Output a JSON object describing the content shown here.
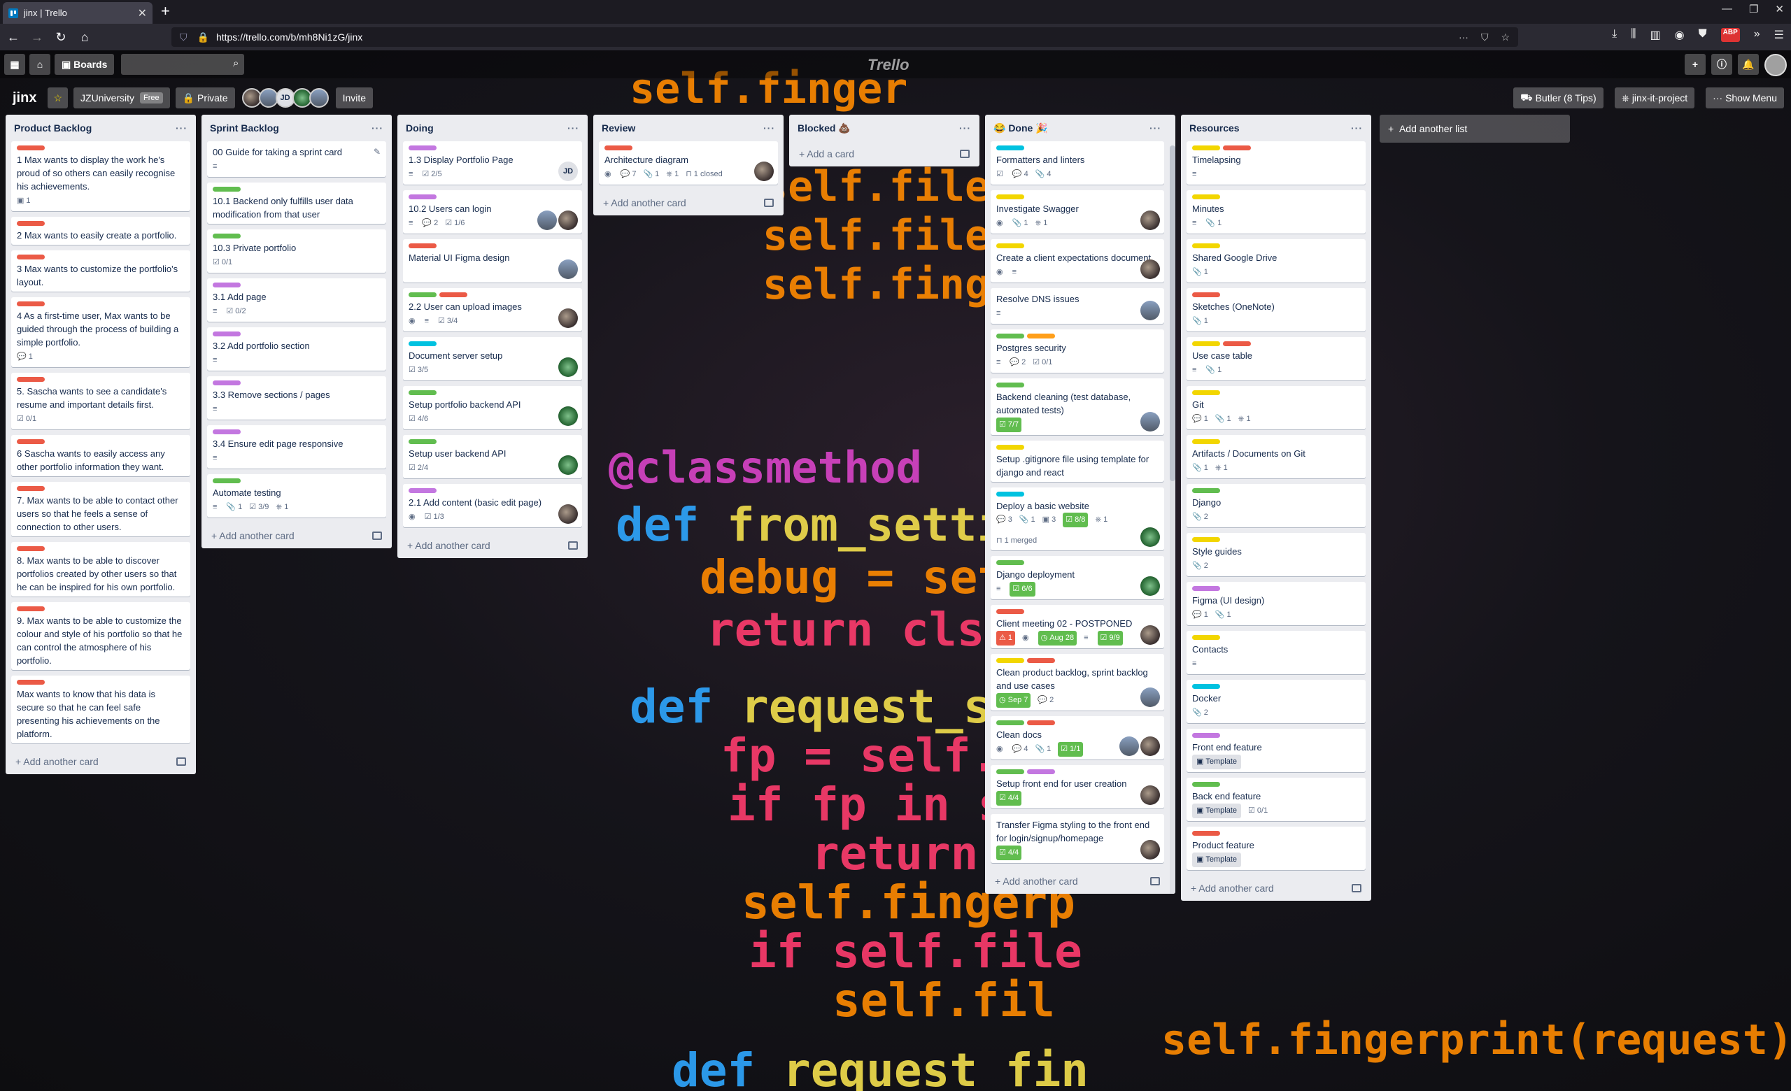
{
  "browser": {
    "tab_title": "jinx | Trello",
    "url": "https://trello.com/b/mh8Ni1zG/jinx"
  },
  "header": {
    "boards_label": "Boards",
    "logo": "Trello"
  },
  "board": {
    "name": "jinx",
    "team": "JZUniversity",
    "team_badge": "Free",
    "visibility": "Private",
    "invite": "Invite",
    "butler": "Butler (8 Tips)",
    "powerup": "jinx-it-project",
    "show_menu": "Show Menu",
    "add_list": "Add another list"
  },
  "lists": [
    {
      "title": "Product Backlog",
      "add": "Add another card",
      "cards": [
        {
          "labels": [
            "#eb5a46"
          ],
          "title": "1 Max wants to display the work he's proud of so others can easily recognise his achievements.",
          "badges": [
            {
              "icon": "▣",
              "text": "1"
            }
          ]
        },
        {
          "labels": [
            "#eb5a46"
          ],
          "title": "2 Max wants to easily create a portfolio.",
          "badges": []
        },
        {
          "labels": [
            "#eb5a46"
          ],
          "title": "3 Max wants to customize the portfolio's layout.",
          "badges": []
        },
        {
          "labels": [
            "#eb5a46"
          ],
          "title": "4 As a first-time user, Max wants to be guided through the process of building a simple portfolio.",
          "badges": [
            {
              "icon": "💬",
              "text": "1"
            }
          ]
        },
        {
          "labels": [
            "#eb5a46"
          ],
          "title": "5. Sascha wants to see a candidate's resume and important details first.",
          "badges": [
            {
              "icon": "☑",
              "text": "0/1"
            }
          ]
        },
        {
          "labels": [
            "#eb5a46"
          ],
          "title": "6 Sascha wants to easily access any other portfolio information they want.",
          "badges": []
        },
        {
          "labels": [
            "#eb5a46"
          ],
          "title": "7. Max wants to be able to contact other users so that he feels a sense of connection to other users.",
          "badges": []
        },
        {
          "labels": [
            "#eb5a46"
          ],
          "title": "8. Max wants to be able to discover portfolios created by other users so that he can be inspired for his own portfolio.",
          "badges": []
        },
        {
          "labels": [
            "#eb5a46"
          ],
          "title": "9. Max wants to be able to customize the colour and style of his portfolio so that he can control the atmosphere of his portfolio.",
          "badges": []
        },
        {
          "labels": [
            "#eb5a46"
          ],
          "title": "Max wants to know that his data is secure so that he can feel safe presenting his achievements on the platform.",
          "badges": []
        }
      ]
    },
    {
      "title": "Sprint Backlog",
      "add": "Add another card",
      "cards": [
        {
          "labels": [],
          "title": "00 Guide for taking a sprint card",
          "badges": [
            {
              "icon": "≡",
              "text": ""
            }
          ],
          "edit": true
        },
        {
          "labels": [
            "#61bd4f"
          ],
          "title": "10.1 Backend only fulfills user data modification from that user",
          "badges": []
        },
        {
          "labels": [
            "#61bd4f"
          ],
          "title": "10.3 Private portfolio",
          "badges": [
            {
              "icon": "☑",
              "text": "0/1"
            }
          ]
        },
        {
          "labels": [
            "#c377e0"
          ],
          "title": "3.1 Add page",
          "badges": [
            {
              "icon": "≡",
              "text": ""
            },
            {
              "icon": "☑",
              "text": "0/2"
            }
          ]
        },
        {
          "labels": [
            "#c377e0"
          ],
          "title": "3.2 Add portfolio section",
          "badges": [
            {
              "icon": "≡",
              "text": ""
            }
          ]
        },
        {
          "labels": [
            "#c377e0"
          ],
          "title": "3.3 Remove sections / pages",
          "badges": [
            {
              "icon": "≡",
              "text": ""
            }
          ]
        },
        {
          "labels": [
            "#c377e0"
          ],
          "title": "3.4 Ensure edit page responsive",
          "badges": [
            {
              "icon": "≡",
              "text": ""
            }
          ]
        },
        {
          "labels": [
            "#61bd4f"
          ],
          "title": "Automate testing",
          "badges": [
            {
              "icon": "≡",
              "text": ""
            },
            {
              "icon": "📎",
              "text": "1"
            },
            {
              "icon": "☑",
              "text": "3/9"
            },
            {
              "icon": "⎈",
              "text": "1"
            }
          ]
        }
      ]
    },
    {
      "title": "Doing",
      "add": "Add another card",
      "cards": [
        {
          "labels": [
            "#c377e0"
          ],
          "title": "1.3 Display Portfolio Page",
          "badges": [
            {
              "icon": "≡",
              "text": ""
            },
            {
              "icon": "☑",
              "text": "2/5"
            }
          ],
          "members": [
            "jd"
          ]
        },
        {
          "labels": [
            "#c377e0"
          ],
          "title": "10.2 Users can login",
          "badges": [
            {
              "icon": "≡",
              "text": ""
            },
            {
              "icon": "💬",
              "text": "2"
            },
            {
              "icon": "☑",
              "text": "1/6"
            }
          ],
          "members": [
            "mt",
            "ph"
          ]
        },
        {
          "labels": [
            "#eb5a46"
          ],
          "title": "Material UI Figma design",
          "badges": [],
          "members": [
            "mt"
          ]
        },
        {
          "labels": [
            "#61bd4f",
            "#eb5a46"
          ],
          "title": "2.2 User can upload images",
          "badges": [
            {
              "icon": "◉",
              "text": ""
            },
            {
              "icon": "≡",
              "text": ""
            },
            {
              "icon": "☑",
              "text": "3/4"
            }
          ],
          "members": [
            "ph"
          ]
        },
        {
          "labels": [
            "#00c2e0"
          ],
          "title": "Document server setup",
          "badges": [
            {
              "icon": "☑",
              "text": "3/5"
            }
          ],
          "members": [
            "sp"
          ]
        },
        {
          "labels": [
            "#61bd4f"
          ],
          "title": "Setup portfolio backend API",
          "badges": [
            {
              "icon": "☑",
              "text": "4/6"
            }
          ],
          "members": [
            "sp"
          ]
        },
        {
          "labels": [
            "#61bd4f"
          ],
          "title": "Setup user backend API",
          "badges": [
            {
              "icon": "☑",
              "text": "2/4"
            }
          ],
          "members": [
            "sp"
          ]
        },
        {
          "labels": [
            "#c377e0"
          ],
          "title": "2.1 Add content (basic edit page)",
          "badges": [
            {
              "icon": "◉",
              "text": ""
            },
            {
              "icon": "☑",
              "text": "1/3"
            }
          ],
          "members": [
            "ph"
          ]
        }
      ]
    },
    {
      "title": "Review",
      "add": "Add another card",
      "cards": [
        {
          "labels": [
            "#eb5a46"
          ],
          "title": "Architecture diagram",
          "badges": [
            {
              "icon": "◉",
              "text": ""
            },
            {
              "icon": "💬",
              "text": "7"
            },
            {
              "icon": "📎",
              "text": "1"
            },
            {
              "icon": "⎈",
              "text": "1"
            },
            {
              "icon": "⊓",
              "text": "1 closed"
            }
          ],
          "members": [
            "ph"
          ]
        }
      ]
    },
    {
      "title": "Blocked 💩",
      "add": "Add a card",
      "cards": []
    },
    {
      "title": "😂 Done 🎉",
      "add": "Add another card",
      "cards": [
        {
          "labels": [
            "#00c2e0"
          ],
          "title": "Formatters and linters",
          "badges": [
            {
              "icon": "☑",
              "text": ""
            },
            {
              "icon": "💬",
              "text": "4"
            },
            {
              "icon": "📎",
              "text": "4"
            }
          ]
        },
        {
          "labels": [
            "#f2d600"
          ],
          "title": "Investigate Swagger",
          "badges": [
            {
              "icon": "◉",
              "text": ""
            },
            {
              "icon": "📎",
              "text": "1"
            },
            {
              "icon": "⎈",
              "text": "1"
            }
          ],
          "members": [
            "ph"
          ]
        },
        {
          "labels": [
            "#f2d600"
          ],
          "title": "Create a client expectations document.",
          "badges": [
            {
              "icon": "◉",
              "text": ""
            },
            {
              "icon": "≡",
              "text": ""
            }
          ],
          "members": [
            "ph"
          ]
        },
        {
          "labels": [],
          "title": "Resolve DNS issues",
          "badges": [
            {
              "icon": "≡",
              "text": ""
            }
          ],
          "members": [
            "mt"
          ]
        },
        {
          "labels": [
            "#61bd4f",
            "#ff9f1a"
          ],
          "title": "Postgres security",
          "badges": [
            {
              "icon": "≡",
              "text": ""
            },
            {
              "icon": "💬",
              "text": "2"
            },
            {
              "icon": "☑",
              "text": "0/1"
            }
          ]
        },
        {
          "labels": [
            "#61bd4f"
          ],
          "title": "Backend cleaning (test database, automated tests)",
          "badges": [
            {
              "icon": "☑",
              "text": "7/7",
              "done": true
            }
          ],
          "members": [
            "mt"
          ]
        },
        {
          "labels": [
            "#f2d600"
          ],
          "title": "Setup .gitignore file using template for django and react",
          "badges": []
        },
        {
          "labels": [
            "#00c2e0"
          ],
          "title": "Deploy a basic website",
          "badges": [
            {
              "icon": "💬",
              "text": "3"
            },
            {
              "icon": "📎",
              "text": "1"
            },
            {
              "icon": "▣",
              "text": "3"
            },
            {
              "icon": "☑",
              "text": "8/8",
              "done": true
            },
            {
              "icon": "⎈",
              "text": "1"
            },
            {
              "icon": "⊓",
              "text": "1 merged"
            }
          ],
          "members": [
            "sp"
          ]
        },
        {
          "labels": [
            "#61bd4f"
          ],
          "title": "Django deployment",
          "badges": [
            {
              "icon": "≡",
              "text": ""
            },
            {
              "icon": "☑",
              "text": "6/6",
              "done": true
            }
          ],
          "members": [
            "sp"
          ]
        },
        {
          "labels": [
            "#eb5a46"
          ],
          "title": "Client meeting 02 - POSTPONED",
          "badges": [
            {
              "icon": "⚠",
              "text": "1",
              "warn": true
            },
            {
              "icon": "◉",
              "text": ""
            },
            {
              "icon": "◷",
              "text": "Aug 28",
              "done": true
            },
            {
              "icon": "≡",
              "text": ""
            },
            {
              "icon": "☑",
              "text": "9/9",
              "done": true
            }
          ],
          "members": [
            "ph"
          ]
        },
        {
          "labels": [
            "#f2d600",
            "#eb5a46"
          ],
          "title": "Clean product backlog, sprint backlog and use cases",
          "badges": [
            {
              "icon": "◷",
              "text": "Sep 7",
              "done": true
            },
            {
              "icon": "💬",
              "text": "2"
            }
          ],
          "members": [
            "mt"
          ]
        },
        {
          "labels": [
            "#61bd4f",
            "#eb5a46"
          ],
          "title": "Clean docs",
          "badges": [
            {
              "icon": "◉",
              "text": ""
            },
            {
              "icon": "💬",
              "text": "4"
            },
            {
              "icon": "📎",
              "text": "1"
            },
            {
              "icon": "☑",
              "text": "1/1",
              "done": true
            }
          ],
          "members": [
            "mt",
            "ph"
          ]
        },
        {
          "labels": [
            "#61bd4f",
            "#c377e0"
          ],
          "title": "Setup front end for user creation",
          "badges": [
            {
              "icon": "☑",
              "text": "4/4",
              "done": true
            }
          ],
          "members": [
            "ph"
          ]
        },
        {
          "labels": [],
          "title": "Transfer Figma styling to the front end for login/signup/homepage",
          "badges": [
            {
              "icon": "☑",
              "text": "4/4",
              "done": true
            }
          ],
          "members": [
            "ph"
          ]
        }
      ]
    },
    {
      "title": "Resources",
      "add": "Add another card",
      "cards": [
        {
          "labels": [
            "#f2d600",
            "#eb5a46"
          ],
          "title": "Timelapsing",
          "badges": [
            {
              "icon": "≡",
              "text": ""
            }
          ]
        },
        {
          "labels": [
            "#f2d600"
          ],
          "title": "Minutes",
          "badges": [
            {
              "icon": "≡",
              "text": ""
            },
            {
              "icon": "📎",
              "text": "1"
            }
          ]
        },
        {
          "labels": [
            "#f2d600"
          ],
          "title": "Shared Google Drive",
          "badges": [
            {
              "icon": "📎",
              "text": "1"
            }
          ]
        },
        {
          "labels": [
            "#eb5a46"
          ],
          "title": "Sketches (OneNote)",
          "badges": [
            {
              "icon": "📎",
              "text": "1"
            }
          ]
        },
        {
          "labels": [
            "#f2d600",
            "#eb5a46"
          ],
          "title": "Use case table",
          "badges": [
            {
              "icon": "≡",
              "text": ""
            },
            {
              "icon": "📎",
              "text": "1"
            }
          ]
        },
        {
          "labels": [
            "#f2d600"
          ],
          "title": "Git",
          "badges": [
            {
              "icon": "💬",
              "text": "1"
            },
            {
              "icon": "📎",
              "text": "1"
            },
            {
              "icon": "⎈",
              "text": "1"
            }
          ]
        },
        {
          "labels": [
            "#f2d600"
          ],
          "title": "Artifacts / Documents on Git",
          "badges": [
            {
              "icon": "📎",
              "text": "1"
            },
            {
              "icon": "⎈",
              "text": "1"
            }
          ]
        },
        {
          "labels": [
            "#61bd4f"
          ],
          "title": "Django",
          "badges": [
            {
              "icon": "📎",
              "text": "2"
            }
          ]
        },
        {
          "labels": [
            "#f2d600"
          ],
          "title": "Style guides",
          "badges": [
            {
              "icon": "📎",
              "text": "2"
            }
          ]
        },
        {
          "labels": [
            "#c377e0"
          ],
          "title": "Figma (UI design)",
          "badges": [
            {
              "icon": "💬",
              "text": "1"
            },
            {
              "icon": "📎",
              "text": "1"
            }
          ]
        },
        {
          "labels": [
            "#f2d600"
          ],
          "title": "Contacts",
          "badges": [
            {
              "icon": "≡",
              "text": ""
            }
          ]
        },
        {
          "labels": [
            "#00c2e0"
          ],
          "title": "Docker",
          "badges": [
            {
              "icon": "📎",
              "text": "2"
            }
          ]
        },
        {
          "labels": [
            "#c377e0"
          ],
          "title": "Front end feature",
          "badges": [
            {
              "icon": "▣",
              "text": "Template",
              "tmpl": true
            }
          ]
        },
        {
          "labels": [
            "#61bd4f"
          ],
          "title": "Back end feature",
          "badges": [
            {
              "icon": "▣",
              "text": "Template",
              "tmpl": true
            },
            {
              "icon": "☑",
              "text": "0/1"
            }
          ]
        },
        {
          "labels": [
            "#eb5a46"
          ],
          "title": "Product feature",
          "badges": [
            {
              "icon": "▣",
              "text": "Template",
              "tmpl": true
            }
          ]
        }
      ]
    }
  ]
}
